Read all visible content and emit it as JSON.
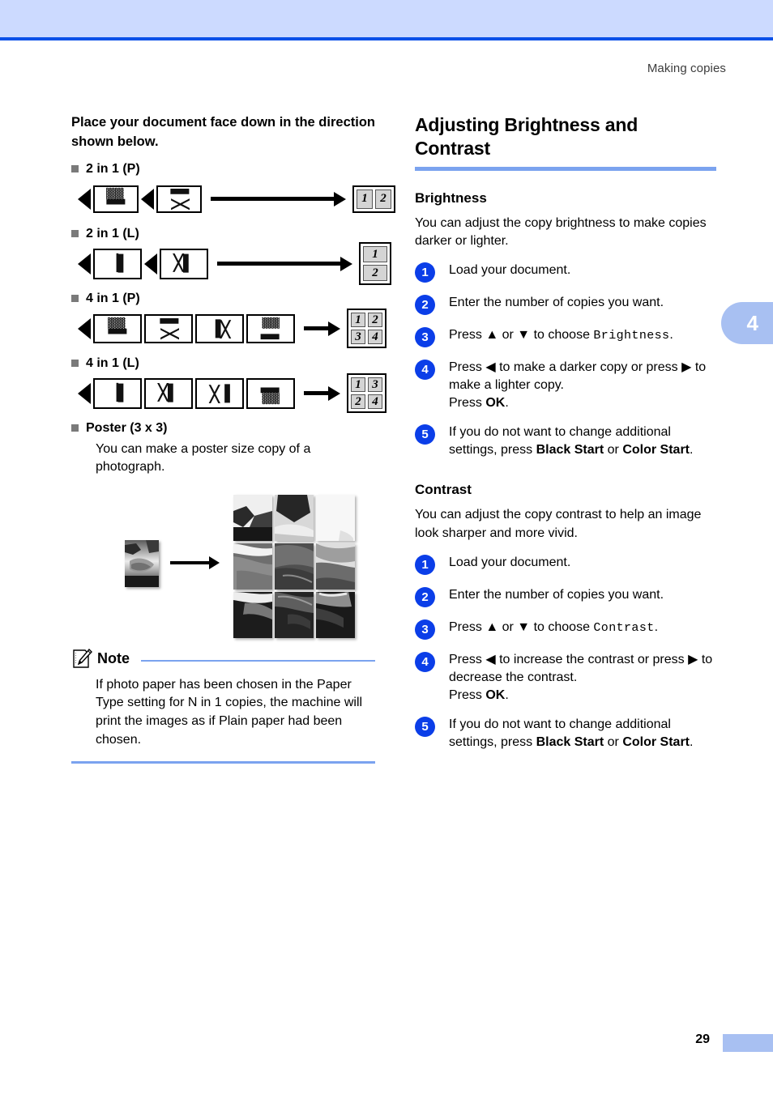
{
  "header": {
    "running_head": "Making copies",
    "band_color": "#ccdaff",
    "rule_color": "#0b50e8"
  },
  "chapter_tab": {
    "number": "4",
    "color": "#a8c0f2"
  },
  "left_column": {
    "lead": "Place your document face down in the direction shown below.",
    "layouts": [
      {
        "label": "2 in 1 (P)",
        "pages": [
          "1",
          "2"
        ],
        "page_rotation": "sideways",
        "arrow": "long",
        "result_grid": "2-across",
        "result_cells": [
          "1",
          "2"
        ]
      },
      {
        "label": "2 in 1 (L)",
        "pages": [
          "1",
          "2"
        ],
        "page_rotation": "upright-tall",
        "arrow": "long",
        "result_grid": "2-down",
        "result_cells": [
          "1",
          "2"
        ]
      },
      {
        "label": "4 in 1 (P)",
        "pages": [
          "1",
          "2",
          "3",
          "4"
        ],
        "page_rotation": "sideways",
        "arrow": "short",
        "result_grid": "2x2",
        "result_cells": [
          "1",
          "2",
          "3",
          "4"
        ]
      },
      {
        "label": "4 in 1 (L)",
        "pages": [
          "1",
          "2",
          "3",
          "4"
        ],
        "page_rotation": "upright-tall",
        "arrow": "short",
        "result_grid": "2x2",
        "result_cells": [
          "1",
          "3",
          "2",
          "4"
        ]
      }
    ],
    "poster": {
      "label_bold": "Poster",
      "label_rest": "(3 x 3)",
      "description": "You can make a poster size copy of a photograph.",
      "image_alt": "handshake photograph tiled into a 3 by 3 poster"
    },
    "note": {
      "title": "Note",
      "icon": "note-pencil-icon",
      "body": "If photo paper has been chosen in the Paper Type setting for N in 1 copies, the machine will print the images as if Plain paper had been chosen.",
      "rule_color": "#7ba3ef"
    }
  },
  "right_column": {
    "heading": "Adjusting Brightness and Contrast",
    "heading_rule_color": "#7ba3ef",
    "sections": [
      {
        "title": "Brightness",
        "intro": "You can adjust the copy brightness to make copies darker or lighter.",
        "steps": [
          {
            "num": "1",
            "parts": [
              {
                "t": "Load your document.",
                "style": "plain"
              }
            ]
          },
          {
            "num": "2",
            "parts": [
              {
                "t": "Enter the number of copies you want.",
                "style": "plain"
              }
            ]
          },
          {
            "num": "3",
            "parts": [
              {
                "t": "Press ▲ or ▼ to choose ",
                "style": "plain"
              },
              {
                "t": "Brightness",
                "style": "mono"
              },
              {
                "t": ".",
                "style": "plain"
              }
            ]
          },
          {
            "num": "4",
            "parts": [
              {
                "t": "Press ◀ to make a darker copy or press ▶ to make a lighter copy.",
                "style": "plain"
              },
              {
                "t": "\n",
                "style": "break"
              },
              {
                "t": "Press ",
                "style": "plain"
              },
              {
                "t": "OK",
                "style": "bold"
              },
              {
                "t": ".",
                "style": "plain"
              }
            ]
          },
          {
            "num": "5",
            "parts": [
              {
                "t": "If you do not want to change additional settings, press ",
                "style": "plain"
              },
              {
                "t": "Black Start",
                "style": "bold"
              },
              {
                "t": " or ",
                "style": "plain"
              },
              {
                "t": "Color Start",
                "style": "bold"
              },
              {
                "t": ".",
                "style": "plain"
              }
            ]
          }
        ]
      },
      {
        "title": "Contrast",
        "intro": "You can adjust the copy contrast to help an image look sharper and more vivid.",
        "steps": [
          {
            "num": "1",
            "parts": [
              {
                "t": "Load your document.",
                "style": "plain"
              }
            ]
          },
          {
            "num": "2",
            "parts": [
              {
                "t": "Enter the number of copies you want.",
                "style": "plain"
              }
            ]
          },
          {
            "num": "3",
            "parts": [
              {
                "t": "Press ▲ or ▼ to choose ",
                "style": "plain"
              },
              {
                "t": "Contrast",
                "style": "mono"
              },
              {
                "t": ".",
                "style": "plain"
              }
            ]
          },
          {
            "num": "4",
            "parts": [
              {
                "t": "Press ◀ to increase the contrast or press ▶ to decrease the contrast.",
                "style": "plain"
              },
              {
                "t": "\n",
                "style": "break"
              },
              {
                "t": "Press ",
                "style": "plain"
              },
              {
                "t": "OK",
                "style": "bold"
              },
              {
                "t": ".",
                "style": "plain"
              }
            ]
          },
          {
            "num": "5",
            "parts": [
              {
                "t": "If you do not want to change additional settings, press ",
                "style": "plain"
              },
              {
                "t": "Black Start",
                "style": "bold"
              },
              {
                "t": " or ",
                "style": "plain"
              },
              {
                "t": "Color Start",
                "style": "bold"
              },
              {
                "t": ".",
                "style": "plain"
              }
            ]
          }
        ]
      }
    ]
  },
  "footer": {
    "page_number": "29",
    "tab_color": "#a8c0f2"
  },
  "colors": {
    "header_band": "#ccdaff",
    "header_rule": "#0b50e8",
    "accent_light_blue": "#7ba3ef",
    "step_circle": "#0b3ee8",
    "bullet_gray": "#7a7a7a"
  }
}
